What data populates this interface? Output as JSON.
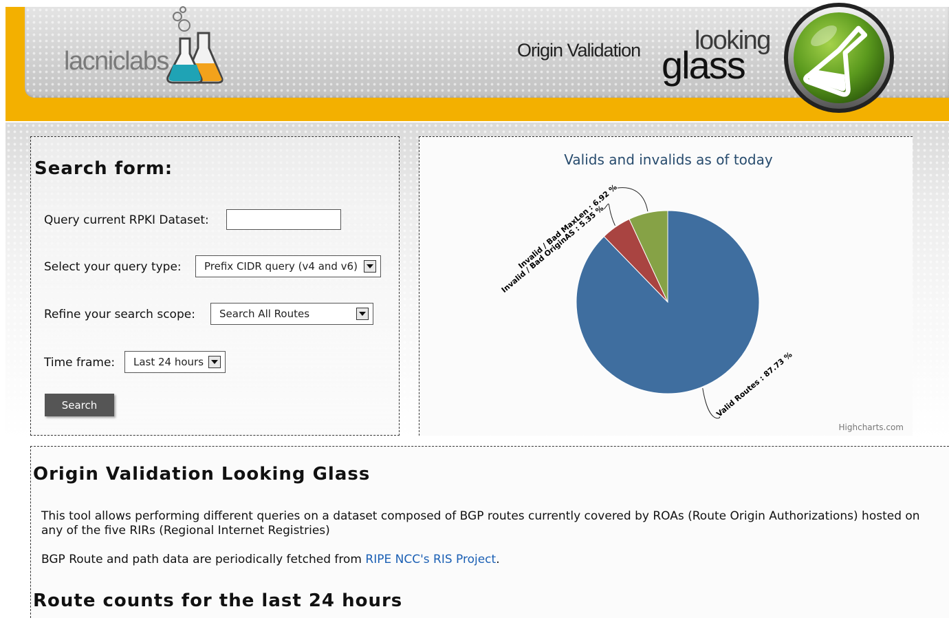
{
  "header": {
    "logo_text": "lacniclabs",
    "origin_validation": "Origin Validation",
    "looking": "looking",
    "glass": "glass"
  },
  "search_form": {
    "title": "Search form:",
    "query_label": "Query current RPKI Dataset:",
    "query_value": "",
    "query_type_label": "Select your query type:",
    "query_type_selected": "Prefix CIDR query (v4 and v6)",
    "scope_label": "Refine your search scope:",
    "scope_selected": "Search All Routes",
    "timeframe_label": "Time frame:",
    "timeframe_selected": "Last 24 hours",
    "search_button": "Search"
  },
  "chart_data": {
    "type": "pie",
    "title": "Valids and invalids as of today",
    "credit": "Highcharts.com",
    "series": [
      {
        "name": "Valid Routes",
        "value": 87.73,
        "label": "Valid Routes : 87.73 %",
        "color": "#3f6e9f"
      },
      {
        "name": "Invalid / Bad OriginAS",
        "value": 5.35,
        "label": "Invalid / Bad OriginAS : 5.35 %",
        "color": "#a94441"
      },
      {
        "name": "Invalid / Bad MaxLen",
        "value": 6.92,
        "label": "Invalid / Bad MaxLen : 6.92 %",
        "color": "#86a246"
      }
    ]
  },
  "about": {
    "title": "Origin Validation Looking Glass",
    "para1": "This tool allows performing different queries on a dataset composed of BGP routes currently covered by ROAs (Route Origin Authorizations) hosted on any of the five RIRs (Regional Internet Registries)",
    "para2_prefix": "BGP Route and path data are periodically fetched from ",
    "para2_link": "RIPE NCC's RIS Project",
    "para2_suffix": ".",
    "counts_title": "Route counts for the last 24 hours"
  },
  "colors": {
    "header_bar": "#f3b000",
    "badge_green": "#5a9a1c",
    "link": "#1a5fb4"
  }
}
